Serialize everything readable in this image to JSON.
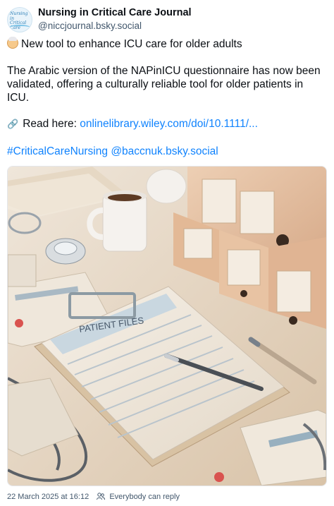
{
  "author": {
    "avatar_text": "Nursing in Critical Care",
    "name": "Nursing in Critical Care Journal",
    "handle": "@niccjournal.bsky.social"
  },
  "post": {
    "headline": "New tool to enhance ICU care for older adults",
    "headline_emoji": "older-person-emoji",
    "body_line1": "The Arabic version of the NAPinICU questionnaire has now been",
    "body_line2": "validated, offering a culturally reliable tool for older patients in",
    "body_line3": "ICU.",
    "read_here_label": "Read here:",
    "read_here_emoji": "link-emoji",
    "link_text": "onlinelibrary.wiley.com/doi/10.1111/...",
    "hashtag": "#CriticalCareNursing",
    "mention": "@baccnuk.bsky.social"
  },
  "image": {
    "description_tag": "illustration",
    "folder_label": "PATIENT FILES"
  },
  "footer": {
    "timestamp": "22 March 2025 at 16:12",
    "reply_setting": "Everybody can reply"
  }
}
